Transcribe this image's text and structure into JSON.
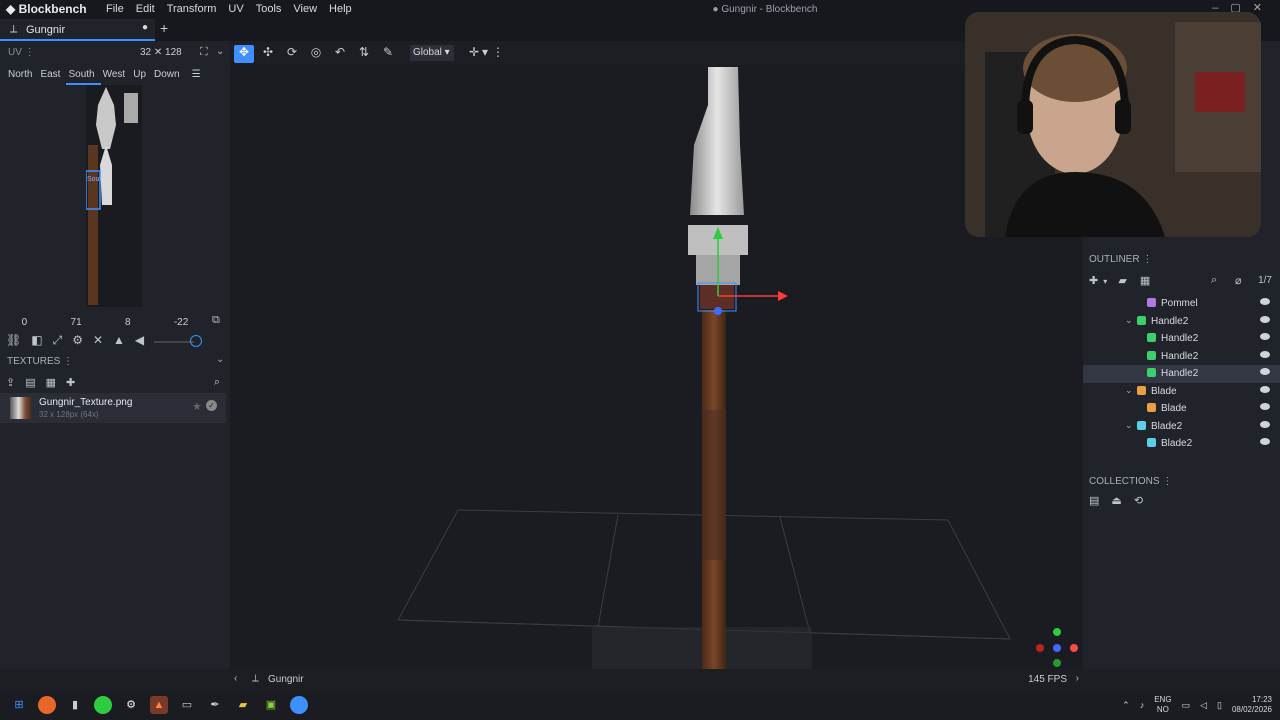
{
  "app": {
    "name": "Blockbench",
    "window_title": "● Gungnir - Blockbench",
    "menu": [
      "File",
      "Edit",
      "Transform",
      "UV",
      "Tools",
      "View",
      "Help"
    ],
    "tab": "Gungnir"
  },
  "uv_panel": {
    "header": "UV",
    "size": "32 ✕ 128",
    "faces": [
      "North",
      "East",
      "South",
      "West",
      "Up",
      "Down"
    ],
    "active_face": "South",
    "values": [
      "0",
      "71",
      "8",
      "-22"
    ],
    "selection_label": "Sout"
  },
  "toolbar": {
    "space": "Global"
  },
  "textures": {
    "header": "TEXTURES",
    "items": [
      {
        "name": "Gungnir_Texture.png",
        "sub": "32 x 128px (64x)"
      }
    ]
  },
  "outliner": {
    "header": "OUTLINER",
    "count": "1/7",
    "nodes": [
      {
        "label": "Pommel",
        "type": "cube-purple",
        "depth": 2
      },
      {
        "label": "Handle2",
        "type": "group-green",
        "depth": 1,
        "expanded": true
      },
      {
        "label": "Handle2",
        "type": "cube-green",
        "depth": 2
      },
      {
        "label": "Handle2",
        "type": "cube-green",
        "depth": 2
      },
      {
        "label": "Handle2",
        "type": "cube-green",
        "depth": 2,
        "selected": true
      },
      {
        "label": "Blade",
        "type": "group-orange",
        "depth": 1,
        "expanded": true
      },
      {
        "label": "Blade",
        "type": "cube-orange",
        "depth": 2
      },
      {
        "label": "Blade2",
        "type": "group-cyan",
        "depth": 1,
        "expanded": true
      },
      {
        "label": "Blade2",
        "type": "cube-cyan",
        "depth": 2
      }
    ]
  },
  "collections": {
    "header": "COLLECTIONS"
  },
  "status": {
    "model": "Gungnir",
    "fps": "145 FPS"
  },
  "taskbar": {
    "lang_top": "ENG",
    "lang_bottom": "NO",
    "time": "17:23",
    "date": "08/02/2026"
  },
  "colors": {
    "accent": "#3e90ff",
    "panel": "#21232a",
    "viewport": "#1b1c21"
  }
}
